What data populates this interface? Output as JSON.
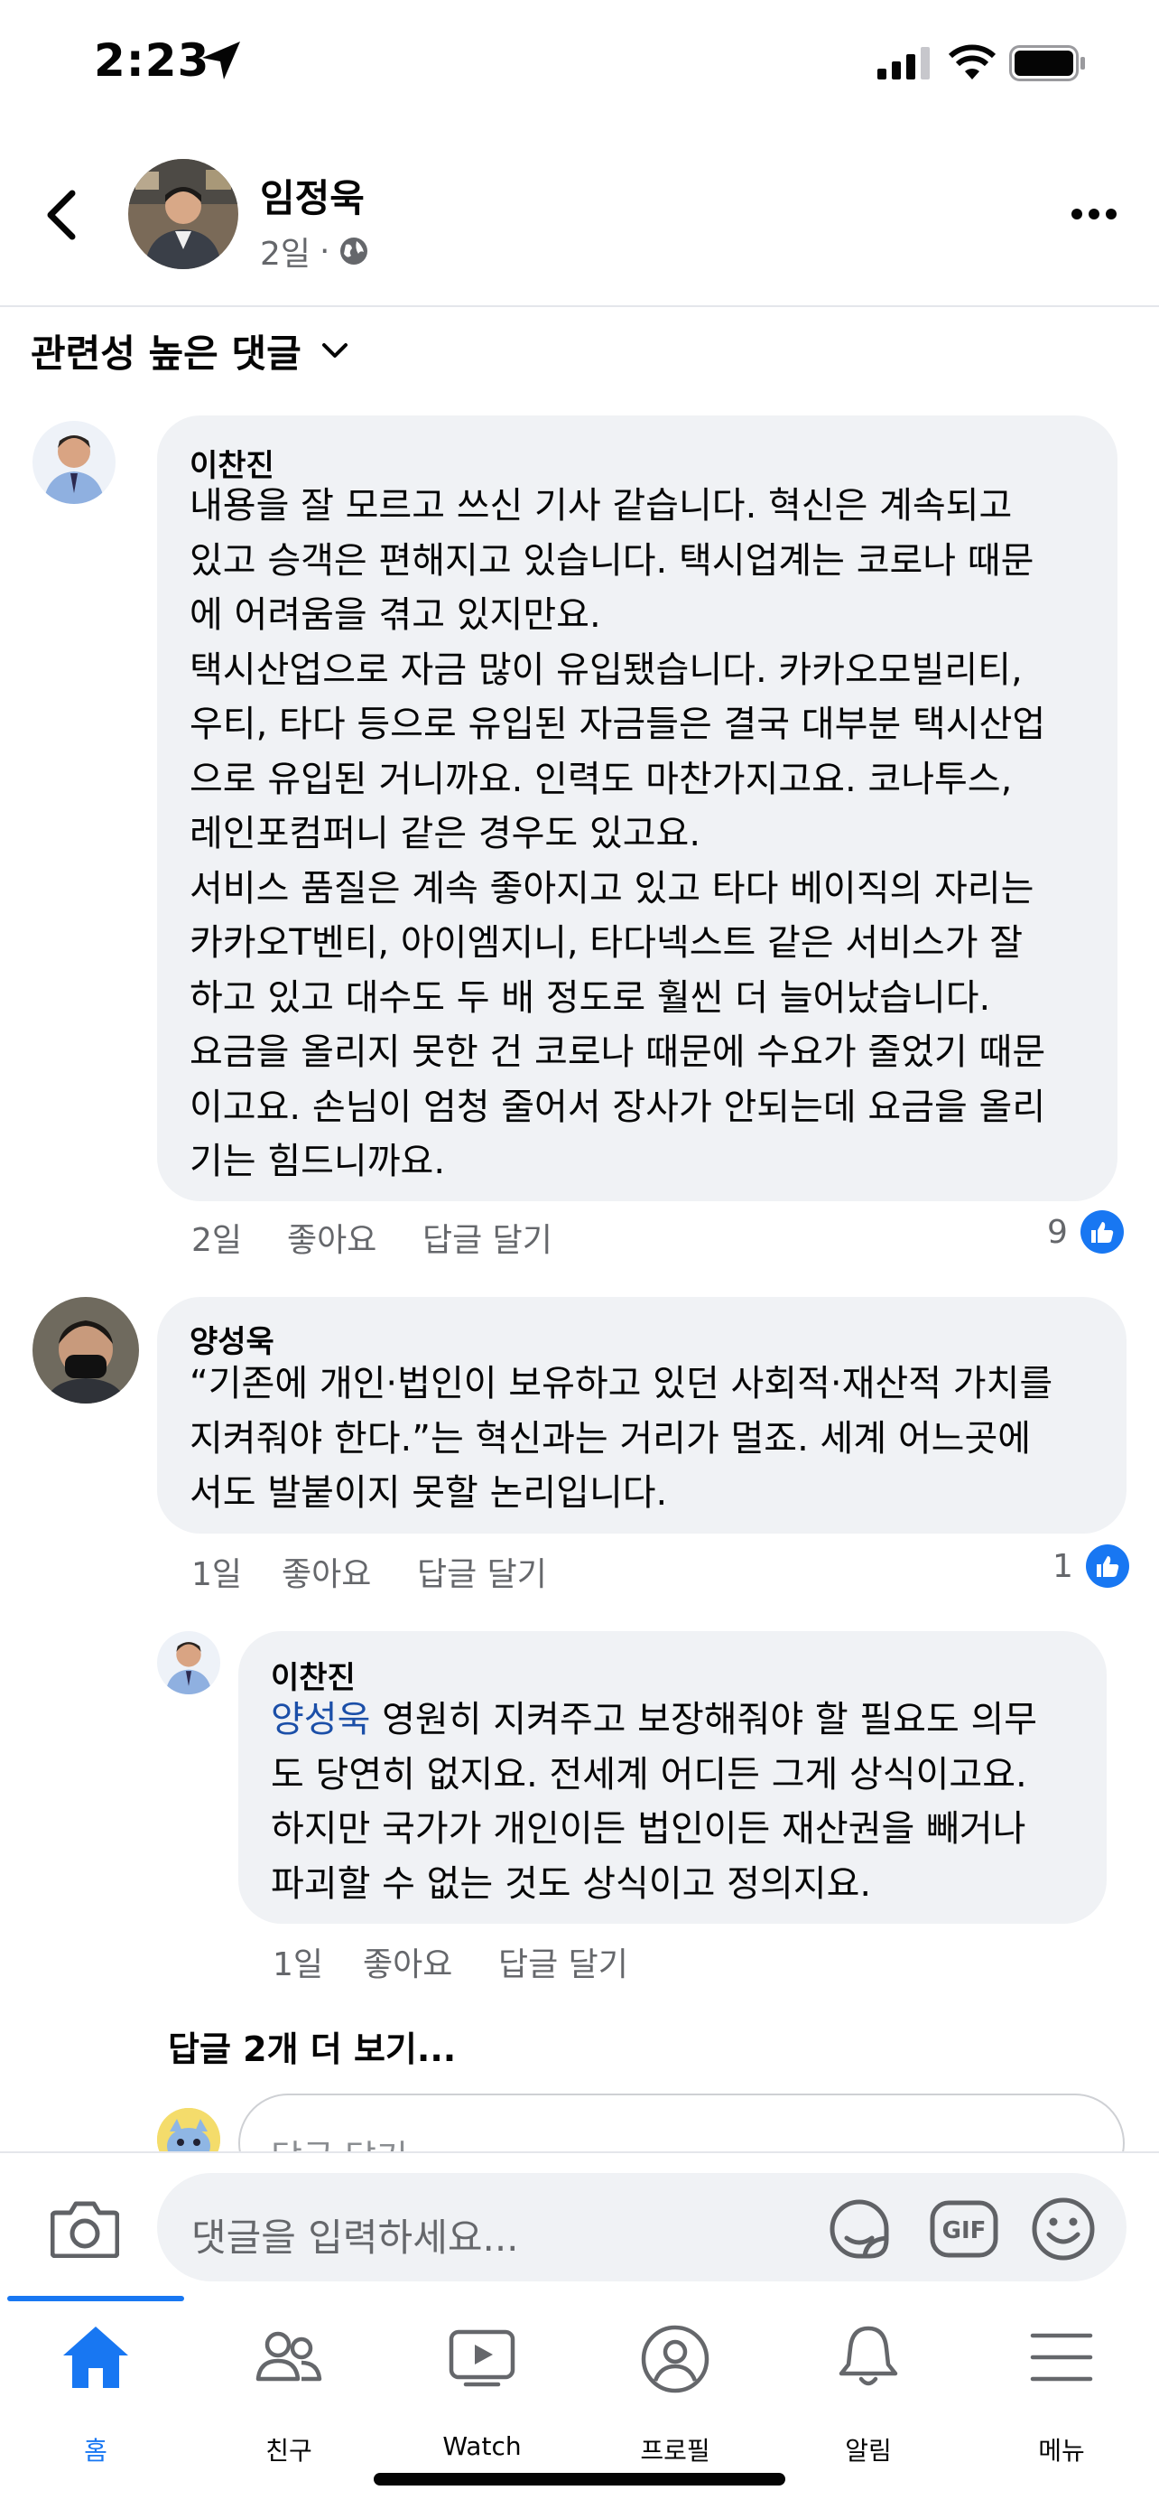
{
  "status_bar": {
    "time": "2:23"
  },
  "post": {
    "author": "임정욱",
    "age": "2일"
  },
  "sort": {
    "label": "관련성 높은 댓글"
  },
  "comments": [
    {
      "author": "이찬진",
      "text": "내용을 잘 모르고 쓰신 기사 같습니다. 혁신은 계속되고\n있고 승객은 편해지고 있습니다. 택시업계는 코로나 때문\n에 어려움을 겪고 있지만요.\n택시산업으로 자금 많이 유입됐습니다. 카카오모빌리티,\n우티, 타다 등으로 유입된 자금들은 결국 대부분 택시산업\n으로 유입된 거니까요. 인력도 마찬가지고요. 코나투스,\n레인포컴퍼니 같은 경우도 있고요.\n서비스 품질은 계속 좋아지고 있고 타다 베이직의 자리는\n카카오T벤티, 아이엠지니, 타다넥스트 같은 서비스가 잘\n하고 있고 대수도 두 배 정도로 훨씬 더 늘어났습니다.\n요금을 올리지 못한 건 코로나 때문에 수요가 줄었기 때문\n이고요. 손님이 엄청 줄어서 장사가 안되는데 요금을 올리\n기는 힘드니까요.",
      "time": "2일",
      "like_label": "좋아요",
      "reply_label": "답글 달기",
      "reactions": "9"
    },
    {
      "author": "양성욱",
      "text": "“기존에 개인·법인이 보유하고 있던 사회적·재산적 가치를\n지켜줘야 한다.”는 혁신과는 거리가 멀죠. 세계 어느곳에\n서도 발붙이지 못할 논리입니다.",
      "time": "1일",
      "like_label": "좋아요",
      "reply_label": "답글 달기",
      "reactions": "1"
    }
  ],
  "reply": {
    "author": "이찬진",
    "mention": "양성욱",
    "text": " 영원히 지켜주고 보장해줘야 할 필요도 의무\n도 당연히 없지요. 전세계 어디든 그게 상식이고요.\n하지만 국가가 개인이든 법인이든 재산권을 빼거나\n파괴할 수 없는 것도 상식이고 정의지요.",
    "time": "1일",
    "like_label": "좋아요",
    "reply_label": "답글 달기"
  },
  "more_replies": "답글 2개 더 보기...",
  "reply_input_placeholder": "답글 달기...",
  "comment_input_placeholder": "댓글을 입력하세요...",
  "gif_label": "GIF",
  "tabs": [
    {
      "label": "홈",
      "icon": "home-icon",
      "active": true
    },
    {
      "label": "친구",
      "icon": "friends-icon"
    },
    {
      "label": "Watch",
      "icon": "watch-icon"
    },
    {
      "label": "프로필",
      "icon": "profile-icon"
    },
    {
      "label": "알림",
      "icon": "bell-icon"
    },
    {
      "label": "메뉴",
      "icon": "menu-icon"
    }
  ],
  "colors": {
    "accent": "#1877f2",
    "bubble": "#f0f2f5",
    "secondary_text": "#65676b",
    "mention": "#1b4fa8"
  }
}
